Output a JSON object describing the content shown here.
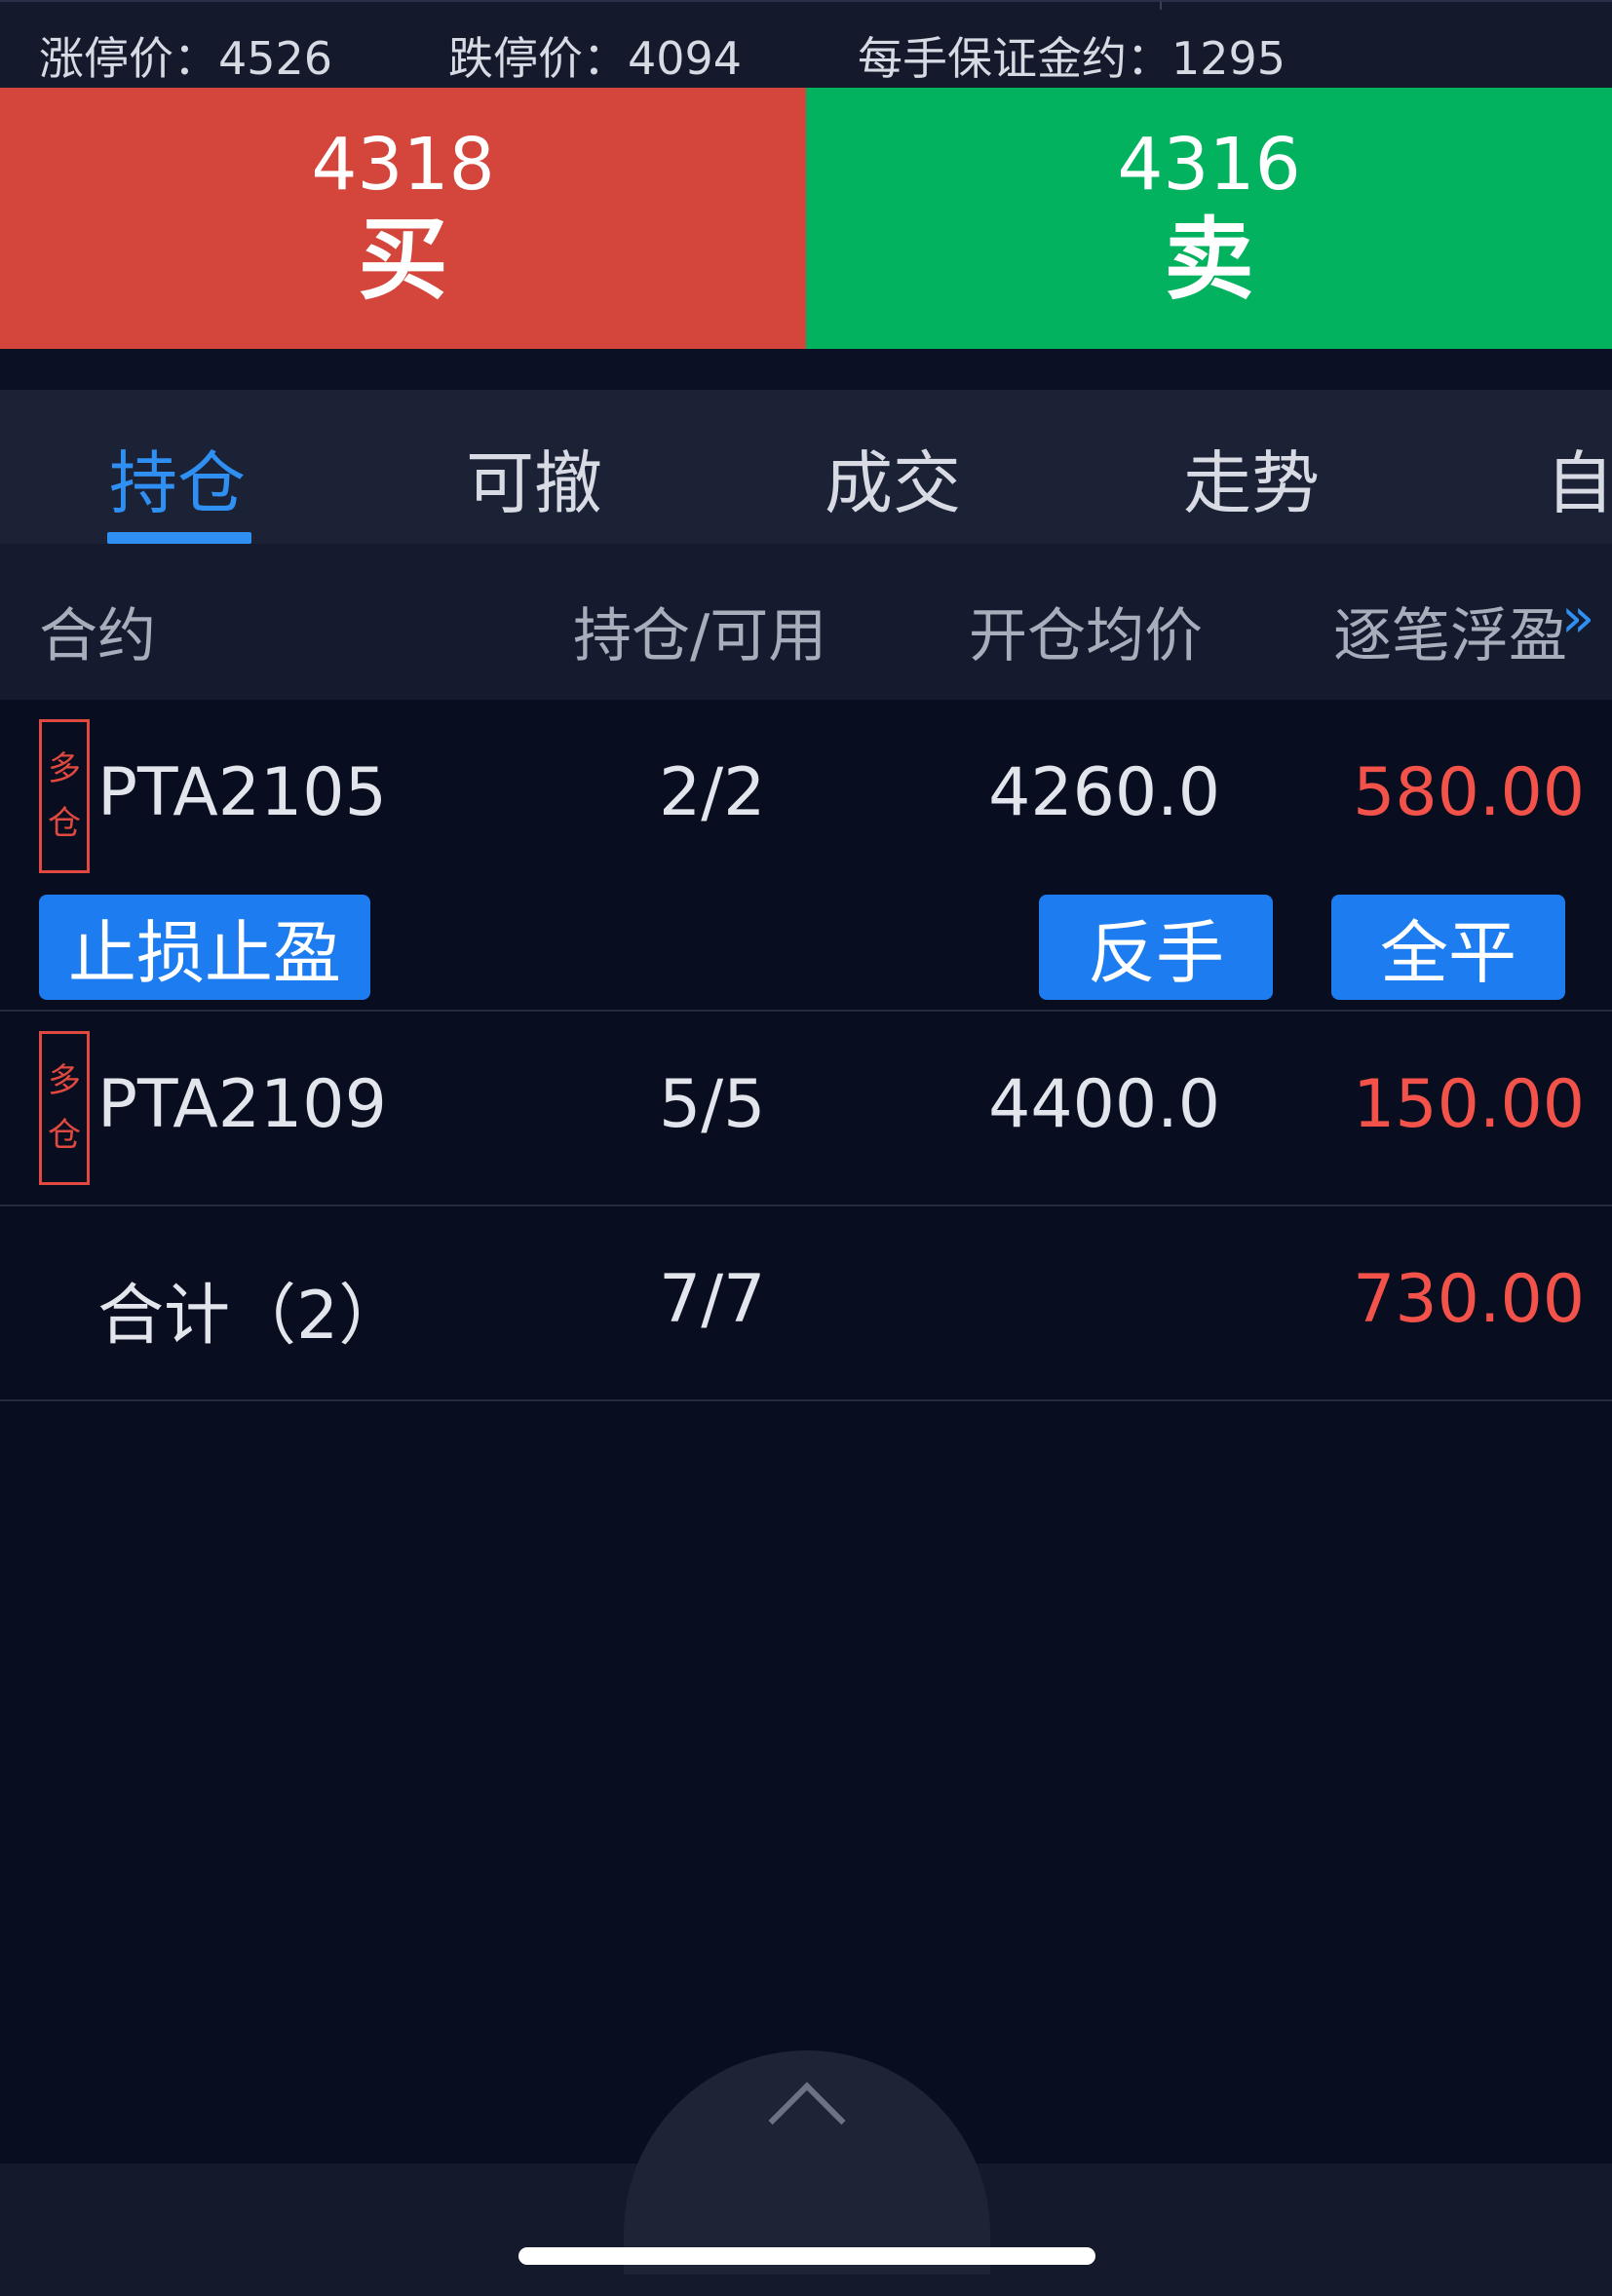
{
  "info_bar": {
    "limit_up": "涨停价：4526",
    "limit_down": "跌停价：4094",
    "margin": "每手保证金约：1295"
  },
  "trade": {
    "buy_price": "4318",
    "buy_label": "买",
    "sell_price": "4316",
    "sell_label": "卖",
    "buy_color": "#d4453b",
    "sell_color": "#03b25f"
  },
  "tabs": [
    {
      "label": "持仓",
      "active": true
    },
    {
      "label": "可撤"
    },
    {
      "label": "成交"
    },
    {
      "label": "走势"
    },
    {
      "label": "自"
    }
  ],
  "table": {
    "headers": {
      "contract": "合约",
      "position": "持仓/可用",
      "avg_price": "开仓均价",
      "profit": "逐笔浮盈"
    },
    "more_icon": "double-chevron-right-icon",
    "rows": [
      {
        "tag_top": "多",
        "tag_bottom": "仓",
        "contract": "PTA2105",
        "position": "2/2",
        "avg_price": "4260.0",
        "profit": "580.00"
      },
      {
        "tag_top": "多",
        "tag_bottom": "仓",
        "contract": "PTA2109",
        "position": "5/5",
        "avg_price": "4400.0",
        "profit": "150.00"
      }
    ],
    "actions": {
      "stop": "止损止盈",
      "reverse": "反手",
      "close_all": "全平"
    },
    "total": {
      "label": "合计（2）",
      "position": "7/7",
      "profit": "730.00"
    }
  },
  "colors": {
    "accent": "#2f8ff2",
    "profit": "#f25249",
    "background": "#080d1f"
  }
}
